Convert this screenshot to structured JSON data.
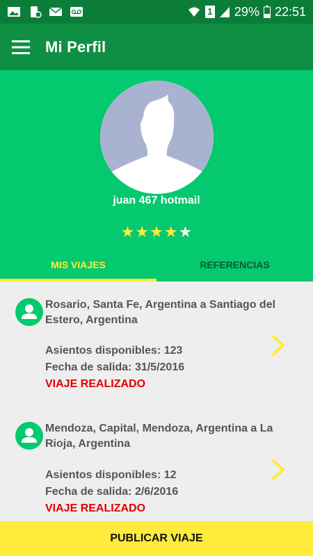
{
  "status_bar": {
    "left_icons": [
      "image-icon",
      "phone-sync-icon",
      "mail-icon",
      "voicemail-icon"
    ],
    "sim_label": "1",
    "battery_percent": "29%",
    "time": "22:51"
  },
  "app_bar": {
    "title": "Mi Perfil",
    "menu_icon": "hamburger-menu-icon"
  },
  "profile": {
    "username": "juan 467 hotmail",
    "rating": 4,
    "rating_max": 5,
    "stars": [
      {
        "glyph": "★"
      },
      {
        "glyph": "★"
      },
      {
        "glyph": "★"
      },
      {
        "glyph": "★"
      },
      {
        "glyph": "★"
      }
    ]
  },
  "tabs": [
    {
      "label": "MIS VIAJES",
      "active": true
    },
    {
      "label": "REFERENCIAS",
      "active": false
    }
  ],
  "trips": [
    {
      "route": "Rosario, Santa Fe, Argentina a Santiago del Estero, Argentina",
      "seats": "Asientos disponibles: 123",
      "date": "Fecha de salida: 31/5/2016",
      "status": "VIAJE REALIZADO"
    },
    {
      "route": "Mendoza, Capital, Mendoza, Argentina a La Rioja, Argentina",
      "seats": "Asientos disponibles: 12",
      "date": "Fecha de salida: 2/6/2016",
      "status": "VIAJE REALIZADO"
    }
  ],
  "publish_button": {
    "label": "PUBLICAR VIAJE"
  },
  "colors": {
    "status_bar": "#0b7d39",
    "app_bar": "#0f8f43",
    "header": "#04c96e",
    "accent_yellow": "#ffeb3b",
    "status_red": "#e00000"
  }
}
